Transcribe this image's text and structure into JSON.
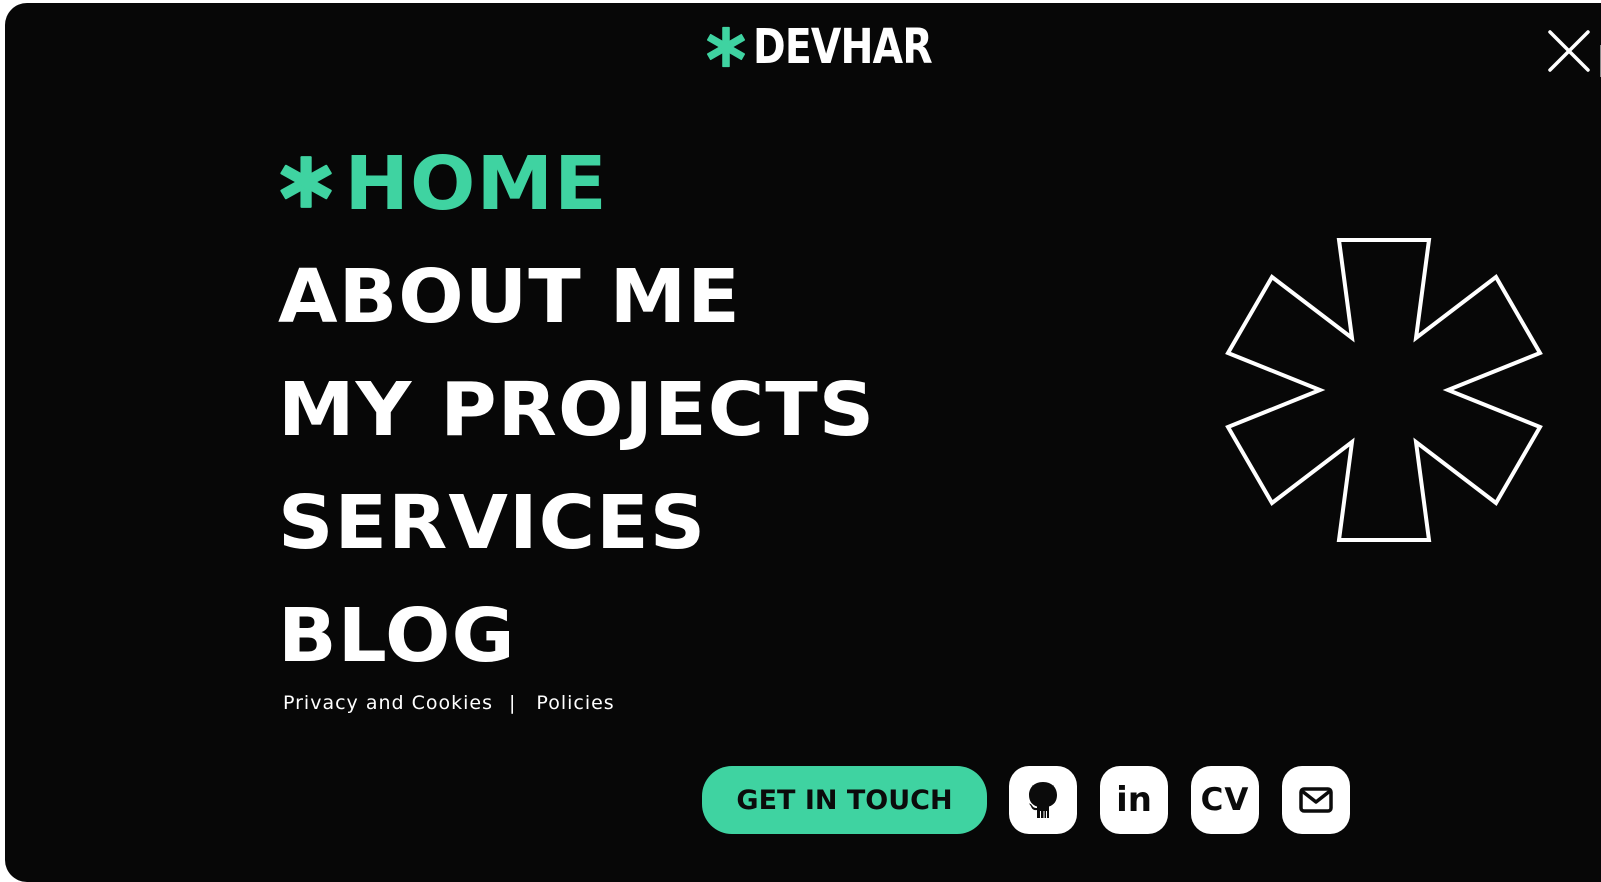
{
  "brand": {
    "name": "DEVHAR",
    "accent_color": "#3fd3a1",
    "star_icon": "asterisk-icon"
  },
  "close": {
    "icon": "close-icon"
  },
  "nav": {
    "items": [
      {
        "label": "HOME",
        "active": true
      },
      {
        "label": "ABOUT ME",
        "active": false
      },
      {
        "label": "MY PROJECTS",
        "active": false
      },
      {
        "label": "SERVICES",
        "active": false
      },
      {
        "label": "BLOG",
        "active": false
      }
    ]
  },
  "legal": {
    "privacy": "Privacy and Cookies",
    "separator": "|",
    "policies": "Policies"
  },
  "cta": {
    "label": "GET IN TOUCH"
  },
  "social": {
    "github_icon": "github-icon",
    "linkedin_label": "in",
    "cv_label": "CV",
    "mail_icon": "mail-icon"
  }
}
